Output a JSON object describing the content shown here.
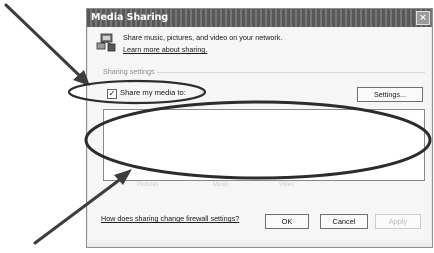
{
  "dialog": {
    "title": "Media Sharing",
    "close_glyph": "×",
    "header_text": "Share music, pictures, and video on your network.",
    "learn_more_link": "Learn more about sharing.",
    "section_label": "Sharing settings",
    "share_checkbox": {
      "label": "Share my media to:",
      "checked": true,
      "check_glyph": "✓"
    },
    "settings_button": "Settings...",
    "list_columns": [
      "Pictures",
      "Music",
      "Video"
    ],
    "firewall_link": "How does sharing change firewall settings?",
    "buttons": {
      "ok": "OK",
      "cancel": "Cancel",
      "apply": "Apply"
    }
  },
  "annotations": {
    "arrow_color": "#404040",
    "highlight_color": "#303030"
  }
}
